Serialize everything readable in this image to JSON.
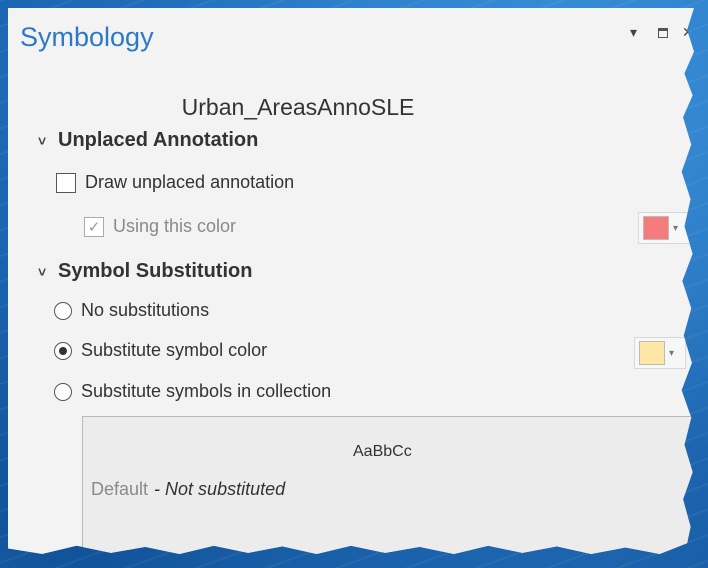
{
  "panel": {
    "title": "Symbology",
    "layer_name": "Urban_AreasAnnoSLE"
  },
  "unplaced": {
    "header": "Unplaced Annotation",
    "draw_label": "Draw unplaced annotation",
    "draw_checked": false,
    "color_label": "Using this color",
    "color_checked": true,
    "color": "#f47c7c"
  },
  "substitution": {
    "header": "Symbol Substitution",
    "options": [
      {
        "label": "No substitutions",
        "selected": false
      },
      {
        "label": "Substitute symbol color",
        "selected": true
      },
      {
        "label": "Substitute symbols in collection",
        "selected": false
      }
    ],
    "color": "#fde6a6",
    "collection": {
      "sample": "AaBbCc",
      "default_label": "Default",
      "default_status": "- Not substituted"
    }
  },
  "icons": {
    "menu": "chevron-down-icon",
    "restore": "restore-icon",
    "close": "close-icon"
  }
}
